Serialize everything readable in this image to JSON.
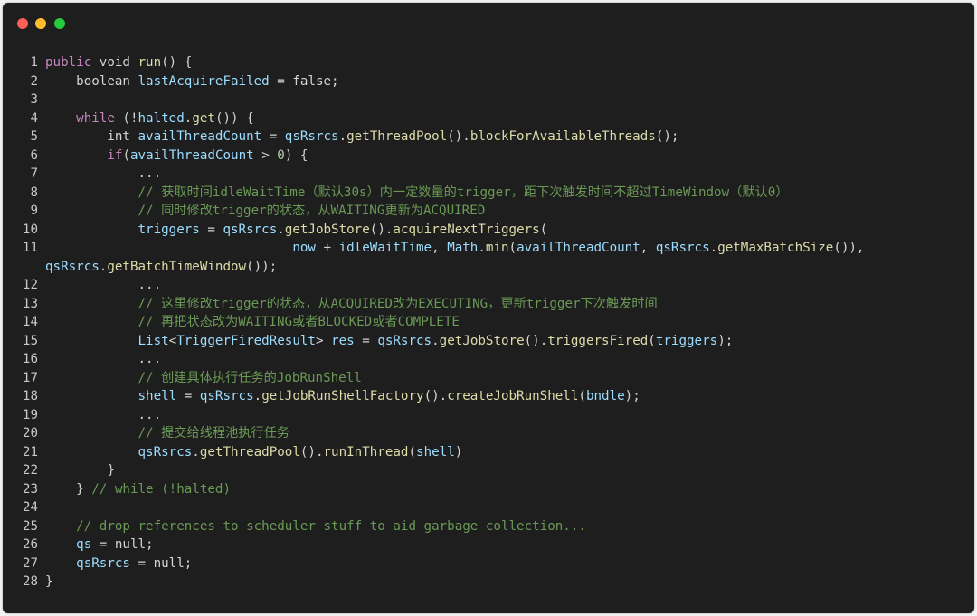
{
  "window": {
    "controls": [
      "close",
      "minimize",
      "maximize"
    ],
    "colors": {
      "background": "#1e1e1e",
      "close": "#ff5f56",
      "minimize": "#ffbd2e",
      "maximize": "#27c93f"
    }
  },
  "code": {
    "language": "java",
    "lines": [
      {
        "n": "1",
        "tokens": [
          [
            "kw",
            "public"
          ],
          [
            "p",
            " void "
          ],
          [
            "fn",
            "run"
          ],
          [
            "p",
            "() {"
          ]
        ]
      },
      {
        "n": "2",
        "tokens": [
          [
            "p",
            "    boolean "
          ],
          [
            "var",
            "lastAcquireFailed"
          ],
          [
            "p",
            " = false;"
          ]
        ]
      },
      {
        "n": "3",
        "tokens": []
      },
      {
        "n": "4",
        "tokens": [
          [
            "p",
            "    "
          ],
          [
            "kw",
            "while"
          ],
          [
            "p",
            " (!"
          ],
          [
            "var",
            "halted"
          ],
          [
            "p",
            "."
          ],
          [
            "fn",
            "get"
          ],
          [
            "p",
            "()) {"
          ]
        ]
      },
      {
        "n": "5",
        "tokens": [
          [
            "p",
            "        int "
          ],
          [
            "var",
            "availThreadCount"
          ],
          [
            "p",
            " = "
          ],
          [
            "var",
            "qsRsrcs"
          ],
          [
            "p",
            "."
          ],
          [
            "fn",
            "getThreadPool"
          ],
          [
            "p",
            "()."
          ],
          [
            "fn",
            "blockForAvailableThreads"
          ],
          [
            "p",
            "();"
          ]
        ]
      },
      {
        "n": "6",
        "tokens": [
          [
            "p",
            "        "
          ],
          [
            "kw",
            "if"
          ],
          [
            "p",
            "("
          ],
          [
            "var",
            "availThreadCount"
          ],
          [
            "p",
            " > "
          ],
          [
            "num",
            "0"
          ],
          [
            "p",
            ") {"
          ]
        ]
      },
      {
        "n": "7",
        "tokens": [
          [
            "p",
            "            ..."
          ]
        ]
      },
      {
        "n": "8",
        "tokens": [
          [
            "p",
            "            "
          ],
          [
            "cm",
            "// 获取时间idleWaitTime（默认30s）内一定数量的trigger，距下次触发时间不超过TimeWindow（默认0）"
          ]
        ]
      },
      {
        "n": "9",
        "tokens": [
          [
            "p",
            "            "
          ],
          [
            "cm",
            "// 同时修改trigger的状态，从WAITING更新为ACQUIRED"
          ]
        ]
      },
      {
        "n": "10",
        "tokens": [
          [
            "p",
            "            "
          ],
          [
            "var",
            "triggers"
          ],
          [
            "p",
            " = "
          ],
          [
            "var",
            "qsRsrcs"
          ],
          [
            "p",
            "."
          ],
          [
            "fn",
            "getJobStore"
          ],
          [
            "p",
            "()."
          ],
          [
            "fn",
            "acquireNextTriggers"
          ],
          [
            "p",
            "("
          ]
        ]
      },
      {
        "n": "11",
        "tokens": [
          [
            "p",
            "                                "
          ],
          [
            "var",
            "now"
          ],
          [
            "p",
            " + "
          ],
          [
            "var",
            "idleWaitTime"
          ],
          [
            "p",
            ", "
          ],
          [
            "var",
            "Math"
          ],
          [
            "p",
            "."
          ],
          [
            "fn",
            "min"
          ],
          [
            "p",
            "("
          ],
          [
            "var",
            "availThreadCount"
          ],
          [
            "p",
            ", "
          ],
          [
            "var",
            "qsRsrcs"
          ],
          [
            "p",
            "."
          ],
          [
            "fn",
            "getMaxBatchSize"
          ],
          [
            "p",
            "()),"
          ]
        ]
      },
      {
        "n": "",
        "tokens": [
          [
            "var",
            "qsRsrcs"
          ],
          [
            "p",
            "."
          ],
          [
            "fn",
            "getBatchTimeWindow"
          ],
          [
            "p",
            "());"
          ]
        ]
      },
      {
        "n": "12",
        "tokens": [
          [
            "p",
            "            ..."
          ]
        ]
      },
      {
        "n": "13",
        "tokens": [
          [
            "p",
            "            "
          ],
          [
            "cm",
            "// 这里修改trigger的状态，从ACQUIRED改为EXECUTING，更新trigger下次触发时间"
          ]
        ]
      },
      {
        "n": "14",
        "tokens": [
          [
            "p",
            "            "
          ],
          [
            "cm",
            "// 再把状态改为WAITING或者BLOCKED或者COMPLETE"
          ]
        ]
      },
      {
        "n": "15",
        "tokens": [
          [
            "p",
            "            "
          ],
          [
            "var",
            "List"
          ],
          [
            "p",
            "<"
          ],
          [
            "var",
            "TriggerFiredResult"
          ],
          [
            "p",
            "> "
          ],
          [
            "var",
            "res"
          ],
          [
            "p",
            " = "
          ],
          [
            "var",
            "qsRsrcs"
          ],
          [
            "p",
            "."
          ],
          [
            "fn",
            "getJobStore"
          ],
          [
            "p",
            "()."
          ],
          [
            "fn",
            "triggersFired"
          ],
          [
            "p",
            "("
          ],
          [
            "var",
            "triggers"
          ],
          [
            "p",
            ");"
          ]
        ]
      },
      {
        "n": "16",
        "tokens": [
          [
            "p",
            "            ..."
          ]
        ]
      },
      {
        "n": "17",
        "tokens": [
          [
            "p",
            "            "
          ],
          [
            "cm",
            "// 创建具体执行任务的JobRunShell"
          ]
        ]
      },
      {
        "n": "18",
        "tokens": [
          [
            "p",
            "            "
          ],
          [
            "var",
            "shell"
          ],
          [
            "p",
            " = "
          ],
          [
            "var",
            "qsRsrcs"
          ],
          [
            "p",
            "."
          ],
          [
            "fn",
            "getJobRunShellFactory"
          ],
          [
            "p",
            "()."
          ],
          [
            "fn",
            "createJobRunShell"
          ],
          [
            "p",
            "("
          ],
          [
            "var",
            "bndle"
          ],
          [
            "p",
            ");"
          ]
        ]
      },
      {
        "n": "19",
        "tokens": [
          [
            "p",
            "            ..."
          ]
        ]
      },
      {
        "n": "20",
        "tokens": [
          [
            "p",
            "            "
          ],
          [
            "cm",
            "// 提交给线程池执行任务"
          ]
        ]
      },
      {
        "n": "21",
        "tokens": [
          [
            "p",
            "            "
          ],
          [
            "var",
            "qsRsrcs"
          ],
          [
            "p",
            "."
          ],
          [
            "fn",
            "getThreadPool"
          ],
          [
            "p",
            "()."
          ],
          [
            "fn",
            "runInThread"
          ],
          [
            "p",
            "("
          ],
          [
            "var",
            "shell"
          ],
          [
            "p",
            ")"
          ]
        ]
      },
      {
        "n": "22",
        "tokens": [
          [
            "p",
            "        }"
          ]
        ]
      },
      {
        "n": "23",
        "tokens": [
          [
            "p",
            "    } "
          ],
          [
            "cm",
            "// while (!halted)"
          ]
        ]
      },
      {
        "n": "24",
        "tokens": []
      },
      {
        "n": "25",
        "tokens": [
          [
            "p",
            "    "
          ],
          [
            "cm",
            "// drop references to scheduler stuff to aid garbage collection..."
          ]
        ]
      },
      {
        "n": "26",
        "tokens": [
          [
            "p",
            "    "
          ],
          [
            "var",
            "qs"
          ],
          [
            "p",
            " = null;"
          ]
        ]
      },
      {
        "n": "27",
        "tokens": [
          [
            "p",
            "    "
          ],
          [
            "var",
            "qsRsrcs"
          ],
          [
            "p",
            " = null;"
          ]
        ]
      },
      {
        "n": "28",
        "tokens": [
          [
            "p",
            "}"
          ]
        ]
      }
    ]
  }
}
